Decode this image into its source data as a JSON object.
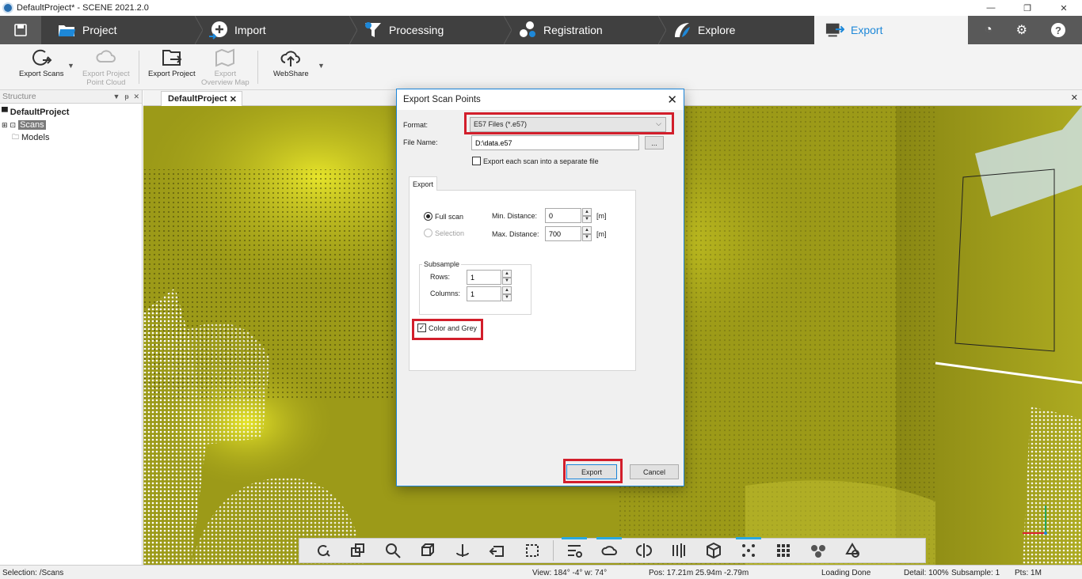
{
  "window": {
    "title": "DefaultProject* - SCENE 2021.2.0",
    "min": "—",
    "max": "❐",
    "close": "✕"
  },
  "tabs": [
    {
      "label": "Project"
    },
    {
      "label": "Import"
    },
    {
      "label": "Processing"
    },
    {
      "label": "Registration"
    },
    {
      "label": "Explore"
    },
    {
      "label": "Export"
    }
  ],
  "ribbon": {
    "export_scans": "Export Scans",
    "export_pc_1": "Export Project",
    "export_pc_2": "Point Cloud",
    "export_project": "Export Project",
    "export_om_1": "Export",
    "export_om_2": "Overview Map",
    "webshare": "WebShare"
  },
  "structure": {
    "title": "Structure",
    "root": "DefaultProject",
    "scans": "Scans",
    "models": "Models"
  },
  "view_tab": {
    "label": "DefaultProject"
  },
  "dialog": {
    "title": "Export Scan Points",
    "format_label": "Format:",
    "format_value": "E57 Files (*.e57)",
    "filename_label": "File Name:",
    "filename_value": "D:\\data.e57",
    "browse": "...",
    "separate": "Export each scan into a separate file",
    "tab": "Export",
    "full_scan": "Full scan",
    "selection": "Selection",
    "min_label": "Min. Distance:",
    "min_value": "0",
    "max_label": "Max. Distance:",
    "max_value": "700",
    "unit": "[m]",
    "subsample": "Subsample",
    "rows_label": "Rows:",
    "rows_value": "1",
    "cols_label": "Columns:",
    "cols_value": "1",
    "color_grey": "Color and Grey",
    "export_btn": "Export",
    "cancel_btn": "Cancel"
  },
  "status": {
    "selection": "Selection: /Scans",
    "view": "View: 184° -4° w: 74°",
    "pos": "Pos: 17.21m 25.94m -2.79m",
    "loading": "Loading Done",
    "detail": "Detail: 100%",
    "subsample": "Subsample: 1",
    "pts": "Pts: 1M"
  },
  "colors": {
    "accent": "#1e88d8",
    "highlight": "#d21e2b",
    "tabbar": "#404040",
    "pointcloud": "#a9a61a"
  }
}
